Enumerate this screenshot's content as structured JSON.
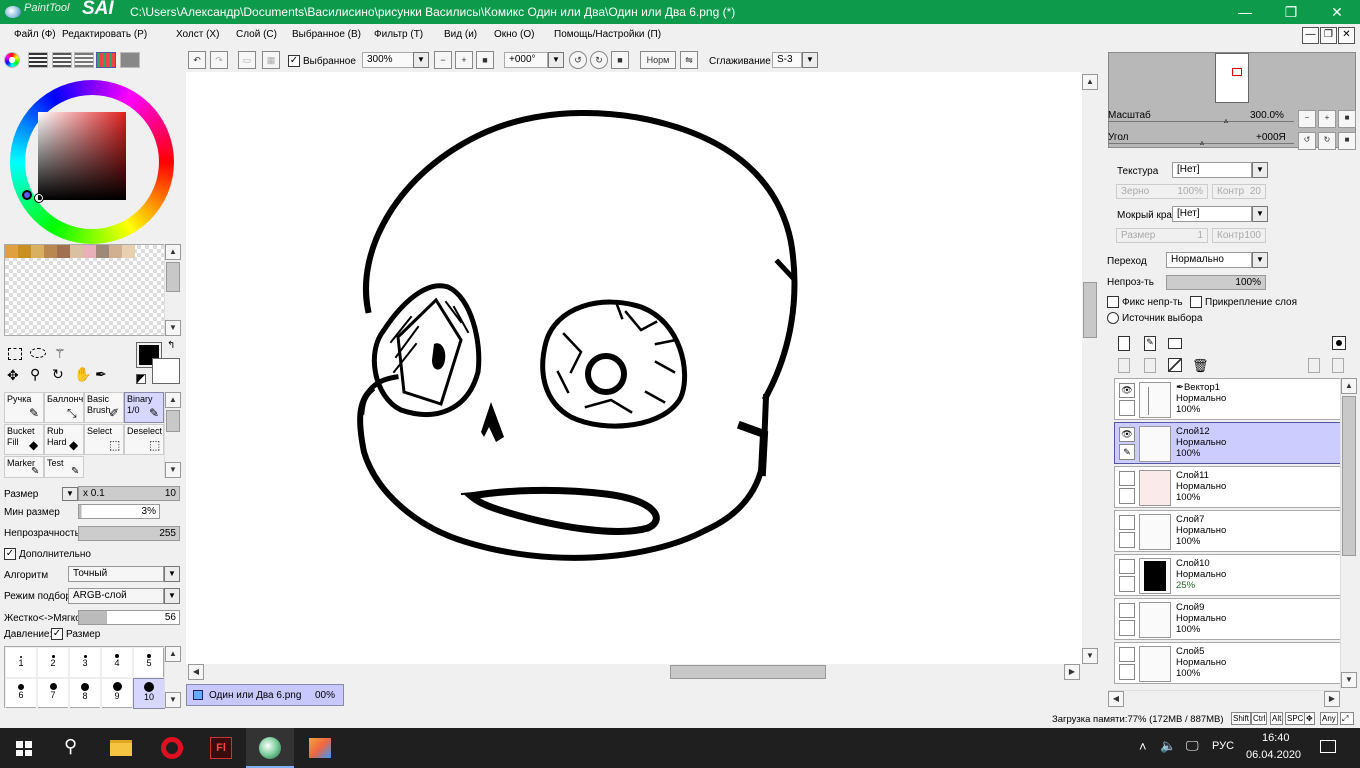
{
  "app": {
    "brand_small": "PaintTool",
    "brand_big": "SAI",
    "title": "C:\\Users\\Александр\\Documents\\Василисино\\рисунки Василисы\\Комикс Один или Два\\Один или Два 6.png (*)"
  },
  "window_controls": {
    "minimize": "—",
    "maximize": "❐",
    "close": "✕"
  },
  "menu": [
    "Файл (Ф)",
    "Редактировать (Р)",
    "Холст (Х)",
    "Слой (С)",
    "Выбранное (В)",
    "Фильтр (Т)",
    "Вид (и)",
    "Окно (О)",
    "Помощь/Настройки (П)"
  ],
  "mdi_controls": {
    "minimize": "—",
    "restore": "❐",
    "close": "✕"
  },
  "canvas_toolbar": {
    "selected_label": "Выбранное",
    "selected_checked": true,
    "zoom": "300%",
    "angle": "+000°",
    "mode": "Норм",
    "smoothing_label": "Сглаживание",
    "smoothing": "S-3"
  },
  "palette": {
    "swatches": [
      "#e0a040",
      "#c89020",
      "#d8b060",
      "#b88850",
      "#a07050",
      "#d8c0a0",
      "#e8b0b8",
      "#a08878",
      "#d0b090",
      "#e8d0b0"
    ],
    "primary_color": "#000000",
    "secondary_color": "#ffffff"
  },
  "tools": [
    {
      "label": "Ручка",
      "icon": "pen-icon"
    },
    {
      "label": "Баллонч",
      "icon": "airbrush-icon"
    },
    {
      "label": "Basic Brush",
      "icon": "brush-icon"
    },
    {
      "label": "Binary 1/0",
      "icon": "binary-pen-icon",
      "selected": true
    },
    {
      "label": "Bucket Fill",
      "icon": "bucket-icon"
    },
    {
      "label": "Rub Hard",
      "icon": "eraser-icon"
    },
    {
      "label": "Select",
      "icon": "select-icon"
    },
    {
      "label": "Deselect",
      "icon": "deselect-icon"
    },
    {
      "label": "Marker",
      "icon": "marker-icon"
    },
    {
      "label": "Test",
      "icon": "test-icon"
    }
  ],
  "brush_settings": {
    "size_label": "Размер",
    "size_mult": "x 0.1",
    "size_value": "10",
    "min_size_label": "Мин размер",
    "min_size_value": "3%",
    "opacity_label": "Непрозрачность",
    "opacity_value": "255",
    "advanced_label": "Дополнительно",
    "advanced_checked": true,
    "algorithm_label": "Алгоритм",
    "algorithm_value": "Точный",
    "sampling_label": "Режим подбора",
    "sampling_value": "ARGB-слой",
    "hardness_label": "Жестко<->Мягко",
    "hardness_value": "56",
    "pressure_label": "Давление:",
    "pressure_size_label": "Размер",
    "pressure_size_checked": true,
    "presets_row1": [
      "1",
      "2",
      "3",
      "4",
      "5"
    ],
    "presets_row2": [
      "6",
      "7",
      "8",
      "9",
      "10"
    ]
  },
  "document_tab": {
    "name": "Один или Два 6.png",
    "progress": "00%"
  },
  "navigator": {
    "scale_label": "Масштаб",
    "scale_value": "300.0%",
    "angle_label": "Угол",
    "angle_value": "+000Я"
  },
  "layer_props": {
    "texture_label": "Текстура",
    "texture_value": "[Нет]",
    "grain_label": "Зерно",
    "grain_value": "100%",
    "contrast_label": "Контр",
    "contrast_value": "20",
    "wet_edge_label": "Мокрый край",
    "wet_edge_value": "[Нет]",
    "size_label": "Размер",
    "size_value": "1",
    "contrast2_label": "Контр",
    "contrast2_value": "100",
    "blend_label": "Переход",
    "blend_value": "Нормально",
    "opacity_label": "Непроз-ть",
    "opacity_value": "100%",
    "fix_opacity_label": "Фикс непр-ть",
    "clip_label": "Прикрепление слоя",
    "source_label": "Источник выбора"
  },
  "layers": [
    {
      "name": "Вектор1",
      "mode": "Нормально",
      "opacity": "100%",
      "visible": true,
      "vector": true
    },
    {
      "name": "Слой12",
      "mode": "Нормально",
      "opacity": "100%",
      "visible": true,
      "selected": true
    },
    {
      "name": "Слой11",
      "mode": "Нормально",
      "opacity": "100%",
      "visible": false
    },
    {
      "name": "Слой7",
      "mode": "Нормально",
      "opacity": "100%",
      "visible": false
    },
    {
      "name": "Слой10",
      "mode": "Нормально",
      "opacity": "25%",
      "visible": false
    },
    {
      "name": "Слой9",
      "mode": "Нормально",
      "opacity": "100%",
      "visible": false
    },
    {
      "name": "Слой5",
      "mode": "Нормально",
      "opacity": "100%",
      "visible": false
    }
  ],
  "status": {
    "memory": "Загрузка памяти:77% (172MB / 887MB)",
    "keys": [
      "Shift",
      "Ctrl",
      "Alt",
      "SPC",
      "✥",
      "Any"
    ]
  },
  "taskbar": {
    "apps": [
      "start-icon",
      "search-icon",
      "file-explorer-icon",
      "opera-icon",
      "flash-icon",
      "painttool-sai-icon",
      "paint-icon"
    ],
    "language": "РУС",
    "time": "16:40",
    "date": "06.04.2020"
  }
}
